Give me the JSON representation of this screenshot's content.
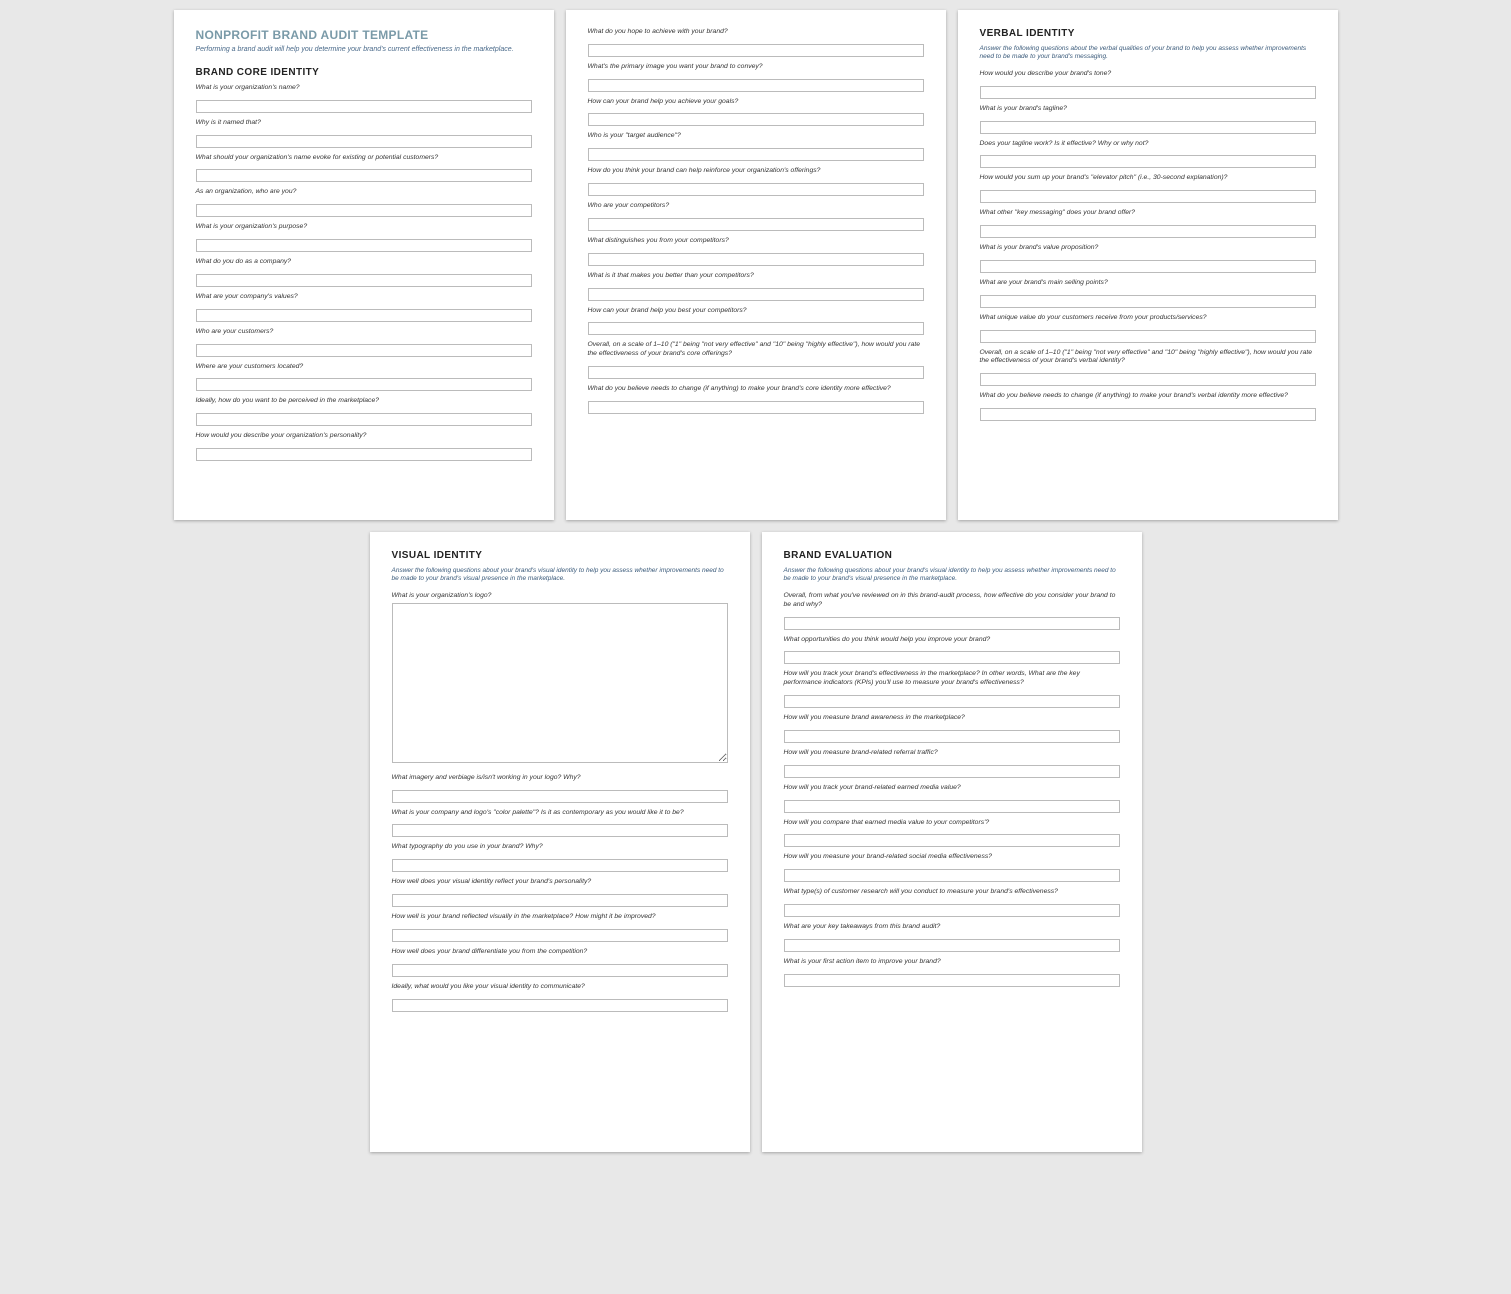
{
  "doc": {
    "title": "NONPROFIT BRAND AUDIT TEMPLATE",
    "subtitle": "Performing a brand audit will help you determine your brand's current effectiveness in the marketplace."
  },
  "sections": {
    "core": {
      "title": "BRAND CORE IDENTITY",
      "q": [
        "What is your organization's name?",
        "Why is it named that?",
        "What should your organization's name evoke for existing or potential customers?",
        "As an organization, who are you?",
        "What is your organization's purpose?",
        "What do you do as a company?",
        "What are your company's values?",
        "Who are your customers?",
        "Where are your customers located?",
        "Ideally, how do you want to be perceived in the marketplace?",
        "How would you describe your organization's personality?"
      ]
    },
    "core2": {
      "q": [
        "What do you hope to achieve with your brand?",
        "What's the primary image you want your brand to convey?",
        "How can your brand help you achieve your goals?",
        "Who is your \"target audience\"?",
        "How do you think your brand can help reinforce your organization's offerings?",
        "Who are your competitors?",
        "What distinguishes you from your competitors?",
        "What is it that makes you better than your competitors?",
        "How can your brand help you best your competitors?",
        "Overall, on a scale of 1–10 (\"1\" being \"not very effective\" and \"10\" being \"highly effective\"), how would you rate the effectiveness of your brand's core offerings?",
        "What do you believe needs to change (if anything) to make your brand's core identity more effective?"
      ]
    },
    "verbal": {
      "title": "VERBAL IDENTITY",
      "sub": "Answer the following questions about the verbal qualities of your brand to help you assess whether improvements need to be made to your brand's messaging.",
      "q": [
        "How would you describe your brand's tone?",
        "What is your brand's tagline?",
        "Does your tagline work? Is it effective? Why or why not?",
        "How would you sum up your brand's \"elevator pitch\" (i.e., 30-second explanation)?",
        "What other \"key messaging\" does your brand offer?",
        "What is your brand's value proposition?",
        "What are your brand's main selling points?",
        "What unique value do your customers receive from your products/services?",
        "Overall, on a scale of 1–10 (\"1\" being \"not very effective\" and \"10\" being \"highly effective\"), how would you rate the effectiveness of your brand's verbal identity?",
        "What do you believe needs to change (if anything) to make your brand's verbal identity more effective?"
      ]
    },
    "visual": {
      "title": "VISUAL IDENTITY",
      "sub": "Answer the following questions about your brand's visual identity to help you assess whether improvements need to be made to your brand's visual presence in the marketplace.",
      "q0": "What is your organization's logo?",
      "q": [
        "What imagery and verbiage is/isn't working in your logo? Why?",
        "What is your company and logo's \"color palette\"? Is it as contemporary as you would like it to be?",
        "What typography do you use in your brand? Why?",
        "How well does your visual identity reflect your brand's personality?",
        "How well is your brand reflected visually in the marketplace? How might it be improved?",
        "How well does your brand differentiate you from the competition?",
        "Ideally, what would you like your visual identity to communicate?"
      ]
    },
    "eval": {
      "title": "BRAND EVALUATION",
      "sub": "Answer the following questions about your brand's visual identity to help you assess whether improvements need to be made to your brand's visual presence in the marketplace.",
      "q": [
        "Overall, from what you've reviewed on in this brand-audit process, how effective do you consider your brand to be and why?",
        "What opportunities do you think would help you improve your brand?",
        "How will you track your brand's effectiveness in the marketplace? In other words, What are the key performance indicators (KPIs) you'll use to measure your brand's effectiveness?",
        "How will you measure brand awareness in the marketplace?",
        "How will you measure brand-related referral traffic?",
        "How will you track your brand-related earned media value?",
        "How will you compare that earned media value to your competitors'?",
        "How will you measure your brand-related social media effectiveness?",
        "What type(s) of customer research will you conduct to measure your brand's effectiveness?",
        "What are your key takeaways from this brand audit?",
        "What is your first action item to improve your brand?"
      ]
    }
  }
}
